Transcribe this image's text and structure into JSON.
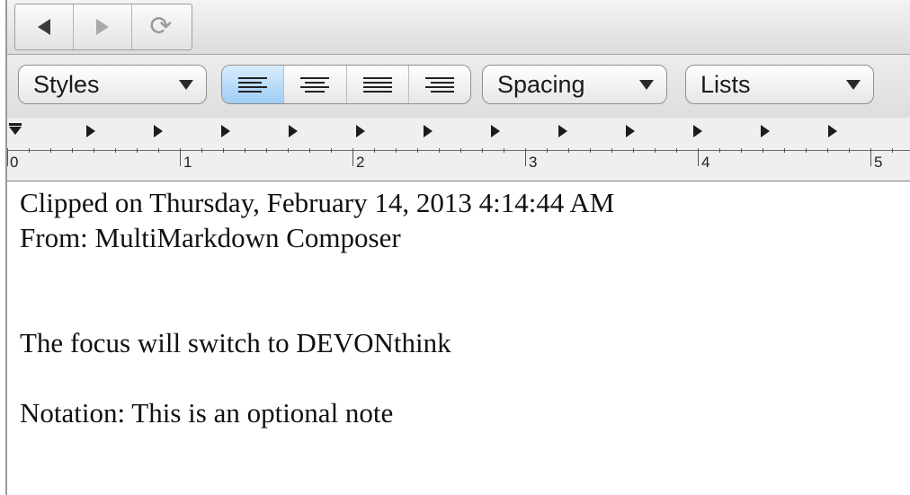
{
  "nav": {
    "back_icon": "back-arrow-icon",
    "forward_icon": "forward-arrow-icon",
    "reload_icon": "reload-icon",
    "reload_glyph": "⟳"
  },
  "formatbar": {
    "styles_label": "Styles",
    "alignment": [
      {
        "name": "align-left",
        "selected": true
      },
      {
        "name": "align-center",
        "selected": false
      },
      {
        "name": "align-justify",
        "selected": false
      },
      {
        "name": "align-right",
        "selected": false
      }
    ],
    "spacing_label": "Spacing",
    "lists_label": "Lists",
    "selected_color": "#9fcdf5"
  },
  "ruler": {
    "numbers": [
      "0",
      "1",
      "2",
      "3",
      "4",
      "5"
    ]
  },
  "document": {
    "line1": "Clipped on Thursday, February 14, 2013 4:14:44 AM",
    "line2": "From: MultiMarkdown Composer",
    "line3": "The focus will switch to DEVONthink",
    "line4": "Notation: This is an optional note"
  }
}
